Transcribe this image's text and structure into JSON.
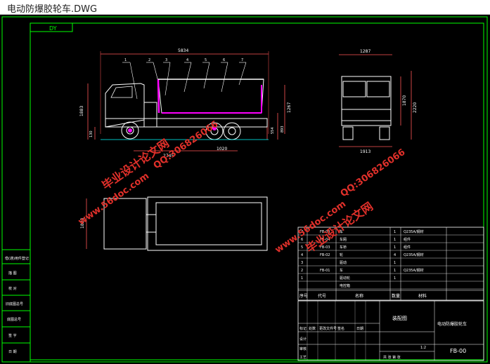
{
  "window": {
    "title": "电动防爆胶轮车.DWG"
  },
  "drawing": {
    "view_label": "DY",
    "side_view": {
      "overall_length": "5834",
      "dims_bottom": [
        "2745",
        "1020"
      ],
      "height_left": "1883",
      "bottom_left": "130",
      "height_right_a": "1267",
      "height_right_b": "554",
      "height_right_c": "893",
      "balloons": [
        "1",
        "2",
        "3",
        "4",
        "5",
        "6",
        "7"
      ]
    },
    "front_view": {
      "top_width": "1287",
      "height_a": "1870",
      "height_b": "2220",
      "bottom_width": "1913"
    },
    "top_view": {
      "width_left": "1823"
    },
    "left_column_labels": [
      "借(通)用件登记",
      "描 图",
      "校 对",
      "旧底图总号",
      "底图总号",
      "签 字",
      "日 期"
    ],
    "parts_table": [
      {
        "no": "7",
        "code": "FB-03",
        "name": "车",
        "qty": "1",
        "material": "Q235A/钢材"
      },
      {
        "no": "6",
        "code": "FB-04",
        "name": "车厢",
        "qty": "1",
        "material": "组件"
      },
      {
        "no": "5",
        "code": "FB-03",
        "name": "车桥",
        "qty": "1",
        "material": "组件"
      },
      {
        "no": "4",
        "code": "FB-02",
        "name": "轮",
        "qty": "4",
        "material": "Q235A/钢材"
      },
      {
        "no": "3",
        "code": "",
        "name": "驱动",
        "qty": "1",
        "material": ""
      },
      {
        "no": "2",
        "code": "FB-01",
        "name": "车",
        "qty": "1",
        "material": "Q235A/钢材"
      },
      {
        "no": "1",
        "code": "",
        "name": "驱动轮",
        "qty": "1",
        "material": ""
      },
      {
        "no": "",
        "code": "",
        "name": "电控箱",
        "qty": "",
        "material": ""
      }
    ],
    "parts_header": [
      "序号",
      "代号",
      "名称",
      "数量",
      "材料"
    ],
    "title_block": {
      "title": "电动防爆胶轮车",
      "assembly": "装配图",
      "drawing_no": "FB-00",
      "scale": "1:2",
      "sheet_labels": [
        "标记",
        "处数",
        "更改文件号",
        "签名",
        "日期"
      ],
      "bottom_labels": [
        "设计",
        "审核",
        "工艺",
        "共 张 第 张"
      ]
    }
  },
  "watermarks": [
    "毕业设计论文网",
    "QQ:306826066",
    "www.56doc.com"
  ],
  "colors": {
    "bg": "#000000",
    "line": "#00ff00",
    "dim": "#ff5555",
    "part": "#ff00ff",
    "body": "#ffffff",
    "cyan": "#00ffff",
    "yellow": "#ffff00",
    "watermark": "#e0302a"
  }
}
